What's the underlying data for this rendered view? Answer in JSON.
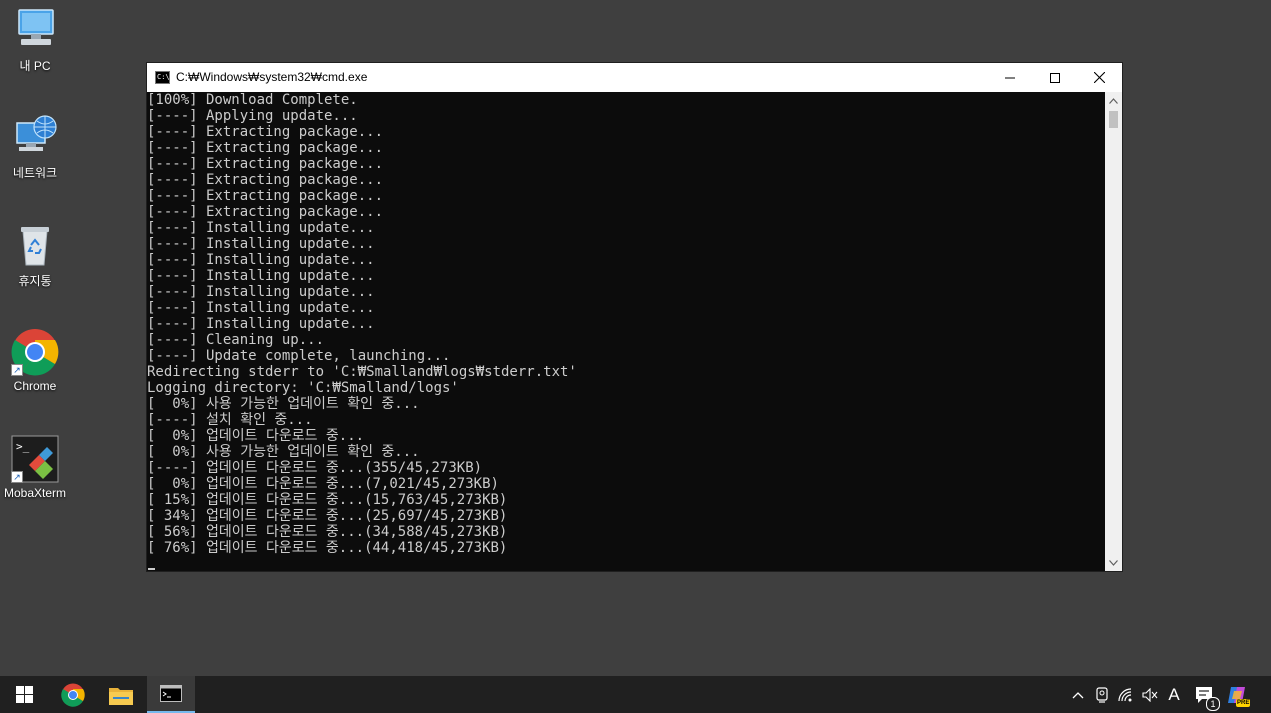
{
  "desktop": {
    "icons": [
      {
        "label": "내 PC",
        "icon": "computer-icon"
      },
      {
        "label": "네트워크",
        "icon": "network-icon"
      },
      {
        "label": "휴지통",
        "icon": "recycle-bin-icon"
      },
      {
        "label": "Chrome",
        "icon": "chrome-icon"
      },
      {
        "label": "MobaXterm",
        "icon": "mobaxterm-icon"
      }
    ]
  },
  "window": {
    "title": "C:₩Windows₩system32₩cmd.exe",
    "app_icon_text": "C:\\",
    "minimize_glyph": "—",
    "maximize_glyph": "☐",
    "close_glyph": "✕"
  },
  "console": {
    "lines": [
      "[100%] Download Complete.",
      "[----] Applying update...",
      "[----] Extracting package...",
      "[----] Extracting package...",
      "[----] Extracting package...",
      "[----] Extracting package...",
      "[----] Extracting package...",
      "[----] Extracting package...",
      "[----] Installing update...",
      "[----] Installing update...",
      "[----] Installing update...",
      "[----] Installing update...",
      "[----] Installing update...",
      "[----] Installing update...",
      "[----] Installing update...",
      "[----] Cleaning up...",
      "[----] Update complete, launching...",
      "Redirecting stderr to 'C:₩Smalland₩logs₩stderr.txt'",
      "Logging directory: 'C:₩Smalland/logs'",
      "[  0%] 사용 가능한 업데이트 확인 중...",
      "[----] 설치 확인 중...",
      "[  0%] 업데이트 다운로드 중...",
      "[  0%] 사용 가능한 업데이트 확인 중...",
      "[----] 업데이트 다운로드 중...(355/45,273KB)",
      "[  0%] 업데이트 다운로드 중...(7,021/45,273KB)",
      "[ 15%] 업데이트 다운로드 중...(15,763/45,273KB)",
      "[ 34%] 업데이트 다운로드 중...(25,697/45,273KB)",
      "[ 56%] 업데이트 다운로드 중...(34,588/45,273KB)",
      "[ 76%] 업데이트 다운로드 중...(44,418/45,273KB)"
    ]
  },
  "taskbar": {
    "items": [
      {
        "name": "start-button",
        "icon": "windows-logo-icon"
      },
      {
        "name": "chrome",
        "icon": "chrome-icon"
      },
      {
        "name": "file-explorer",
        "icon": "folder-icon"
      },
      {
        "name": "cmd",
        "icon": "cmd-icon",
        "active": true
      }
    ],
    "tray": {
      "chevron": "^",
      "ime": "A",
      "notification_count": "1",
      "copilot_badge": "PRE"
    }
  },
  "colors": {
    "desktop_bg": "#3f3f3f",
    "console_bg": "#0c0c0c",
    "console_fg": "#cccccc",
    "taskbar_bg": "#202020",
    "accent": "#76b9ed"
  }
}
